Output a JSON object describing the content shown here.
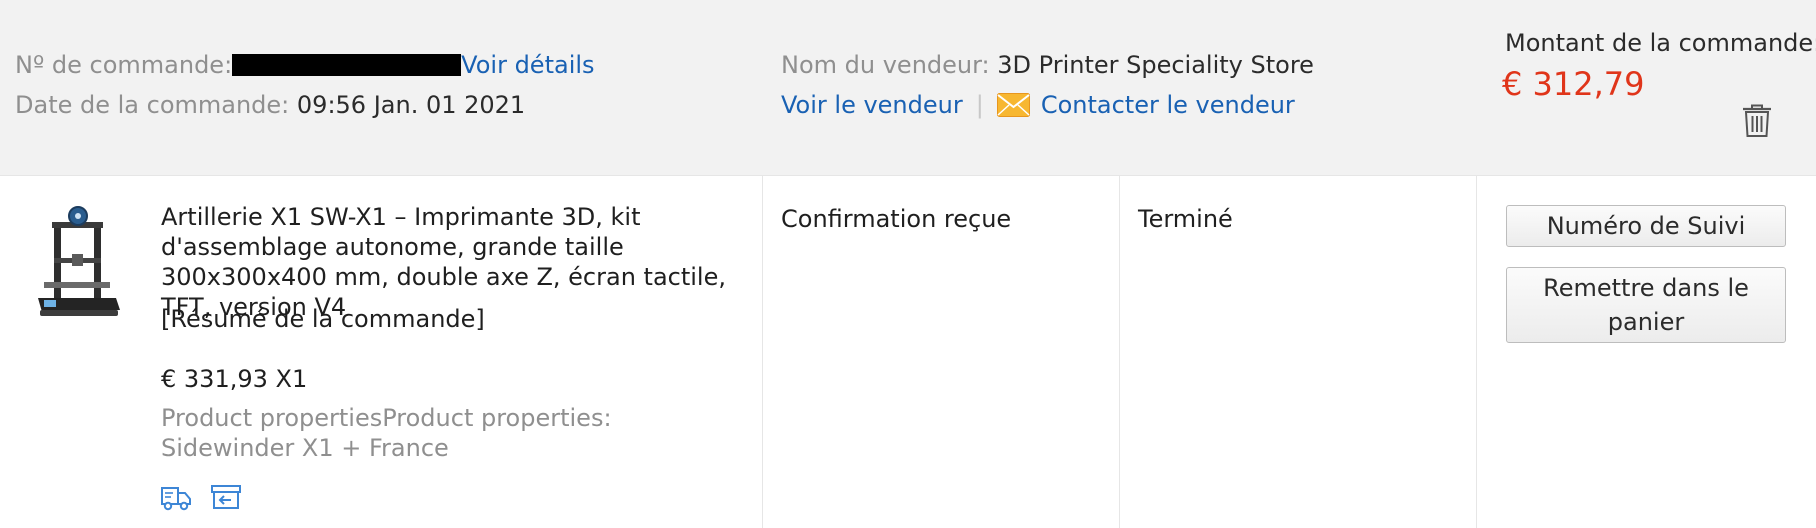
{
  "header": {
    "order_number_label": "Nº de commande:",
    "view_details_link": "Voir détails",
    "order_date_label": "Date de la commande:",
    "order_date_value": "09:56 Jan. 01 2021",
    "seller_name_label": "Nom du vendeur:",
    "seller_name_value": "3D Printer Speciality Store",
    "view_seller_link": "Voir le vendeur",
    "separator": "|",
    "contact_seller_link": "Contacter le vendeur",
    "order_amount_label": "Montant de la commande:",
    "order_amount_value": "€ 312,79"
  },
  "product": {
    "title": "Artillerie X1 SW-X1 – Imprimante 3D, kit d'assemblage autonome, grande taille 300x300x400 mm, double axe Z, écran tactile, TFT, version V4",
    "summary_link": "[Résumé de la commande]",
    "unit_price": "€ 331,93 X1",
    "properties": "Product propertiesProduct properties: Sidewinder X1 + France"
  },
  "status": {
    "confirmation": "Confirmation reçue",
    "state": "Terminé"
  },
  "actions": {
    "tracking_button": "Numéro de Suivi",
    "readd_to_cart_button": "Remettre dans le panier"
  },
  "icons": {
    "mail": "envelope-icon",
    "trash": "trash-icon",
    "shipping": "truck-icon",
    "return": "return-box-icon"
  },
  "colors": {
    "header_bg": "#f2f2f2",
    "link": "#1961b3",
    "price": "#e0351a",
    "muted": "#8f8f8f",
    "mail_icon": "#f5a623"
  }
}
